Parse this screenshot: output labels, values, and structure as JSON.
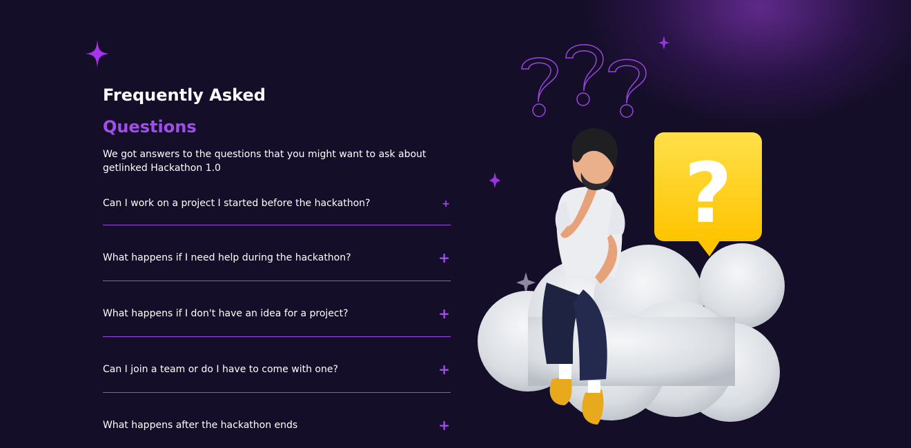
{
  "faq_section": {
    "heading_line1": "Frequently Asked",
    "heading_line2": "Questions",
    "intro": "We got answers to the questions that you might want to ask about getlinked Hackathon 1.0",
    "items": [
      {
        "question": "Can I work on a project I started before the hackathon?",
        "toggle": "+"
      },
      {
        "question": "What happens if I need help during the hackathon?",
        "toggle": "+"
      },
      {
        "question": "What happens if I don't have an idea for a project?",
        "toggle": "+"
      },
      {
        "question": "Can I join a team or do I have to come with one?",
        "toggle": "+"
      },
      {
        "question": "What happens after the hackathon ends",
        "toggle": "+"
      }
    ]
  },
  "illustration": {
    "name": "thinking-man-on-cloud-with-question-marks",
    "bubble_glyph": "?"
  },
  "colors": {
    "background": "#150e28",
    "accent": "#a34df0",
    "divider": "#9a4ee8",
    "bubble": "#ffcc00"
  },
  "icons": [
    "sparkle-star-icon",
    "plus-icon",
    "question-mark-outline-icon"
  ]
}
